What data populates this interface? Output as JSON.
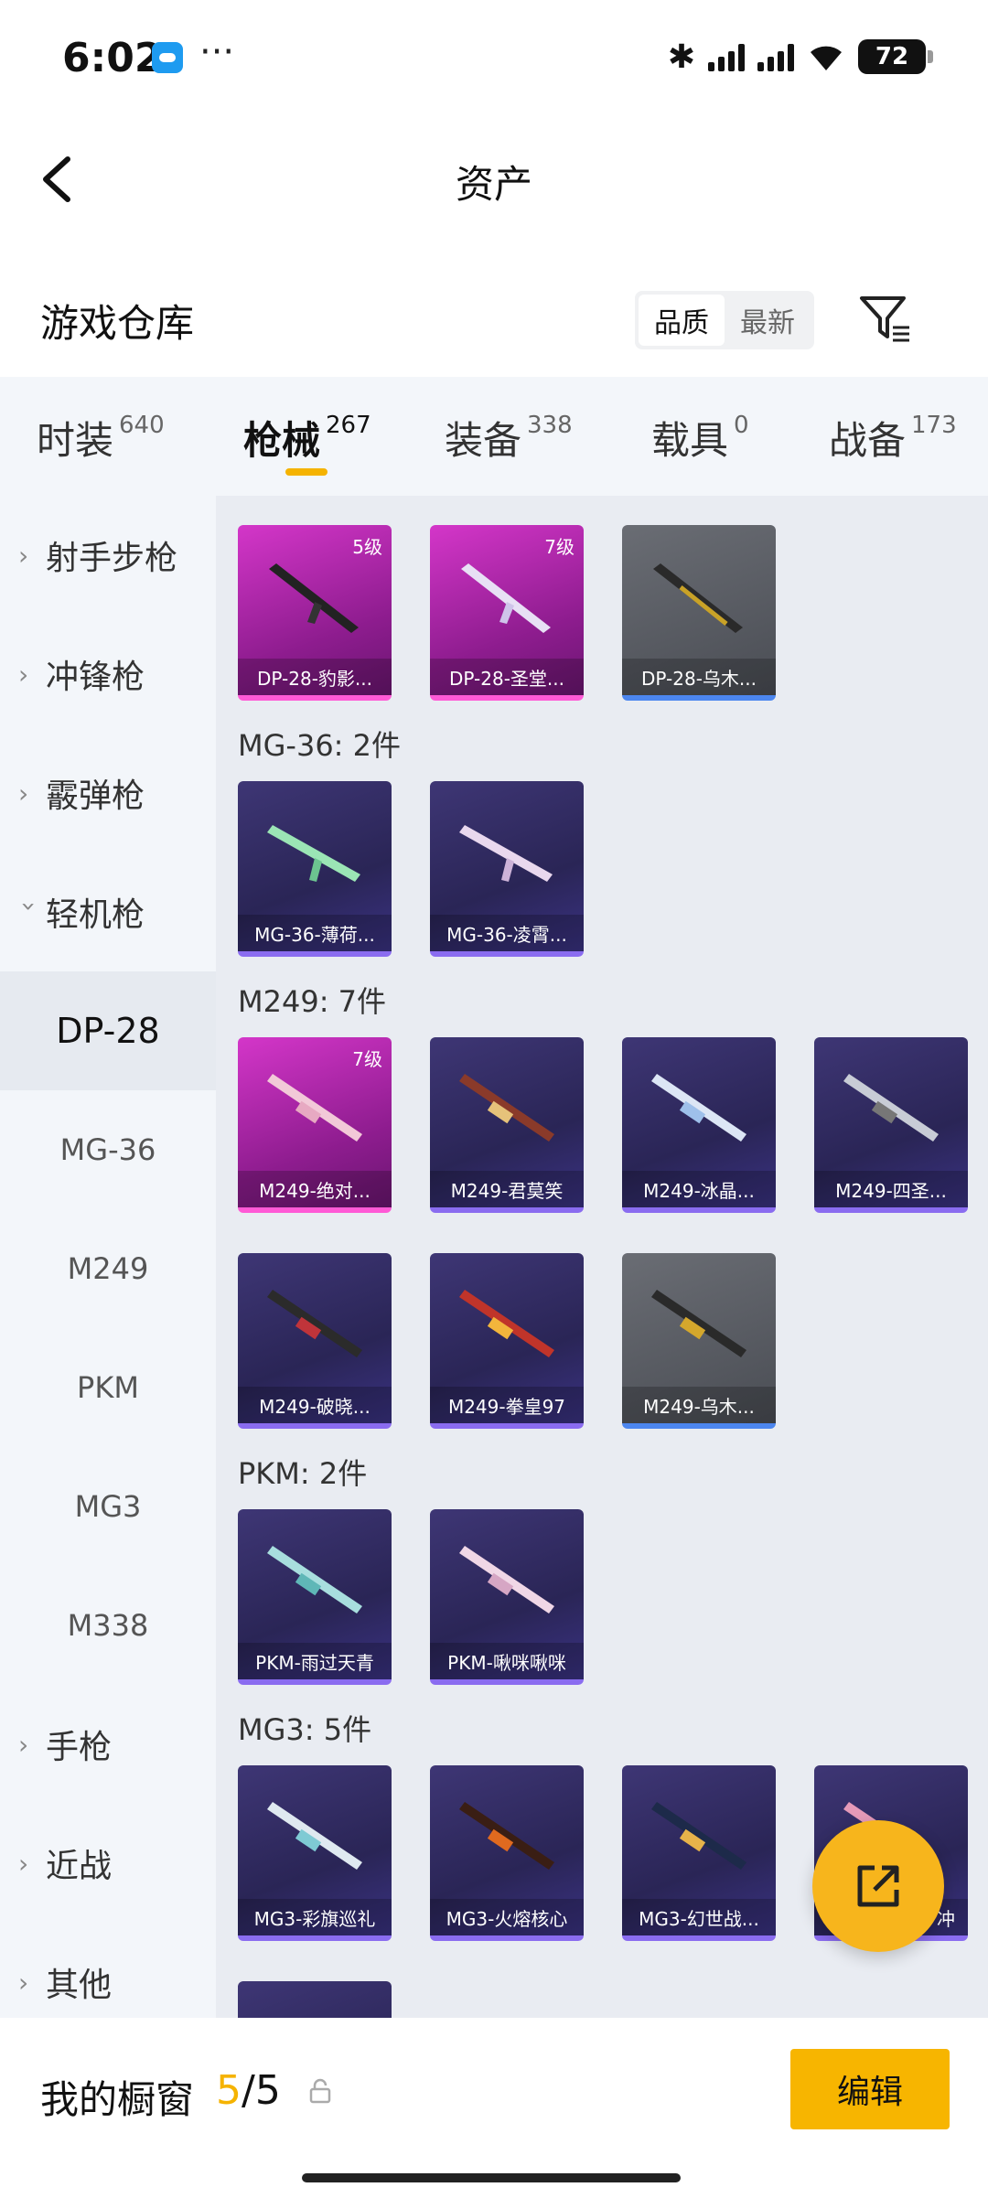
{
  "status": {
    "time": "6:02",
    "battery": "72"
  },
  "header": {
    "title": "资产"
  },
  "warehouse": {
    "title": "游戏仓库",
    "sort": [
      "品质",
      "最新"
    ]
  },
  "tabs": [
    {
      "label": "时装",
      "count": "640"
    },
    {
      "label": "枪械",
      "count": "267"
    },
    {
      "label": "装备",
      "count": "338"
    },
    {
      "label": "载具",
      "count": "0"
    },
    {
      "label": "战备",
      "count": "173"
    }
  ],
  "sidebar": {
    "categories": [
      "射手步枪",
      "冲锋枪",
      "霰弹枪",
      "轻机枪",
      "手枪",
      "近战",
      "其他"
    ],
    "sub": [
      "DP-28",
      "MG-36",
      "M249",
      "PKM",
      "MG3",
      "M338"
    ]
  },
  "content": {
    "dp28": [
      {
        "name": "DP-28-豹影...",
        "level": "5级"
      },
      {
        "name": "DP-28-圣堂...",
        "level": "7级"
      },
      {
        "name": "DP-28-乌木..."
      }
    ],
    "mg36_title": "MG-36: 2件",
    "mg36": [
      {
        "name": "MG-36-薄荷..."
      },
      {
        "name": "MG-36-凌霄..."
      }
    ],
    "m249_title": "M249: 7件",
    "m249": [
      {
        "name": "M249-绝对...",
        "level": "7级"
      },
      {
        "name": "M249-君莫笑"
      },
      {
        "name": "M249-冰晶..."
      },
      {
        "name": "M249-四圣..."
      },
      {
        "name": "M249-破晓..."
      },
      {
        "name": "M249-拳皇97"
      },
      {
        "name": "M249-乌木..."
      }
    ],
    "pkm_title": "PKM: 2件",
    "pkm": [
      {
        "name": "PKM-雨过天青"
      },
      {
        "name": "PKM-啾咪啾咪"
      }
    ],
    "mg3_title": "MG3: 5件",
    "mg3": [
      {
        "name": "MG3-彩旗巡礼"
      },
      {
        "name": "MG3-火熔核心"
      },
      {
        "name": "MG3-幻世战..."
      },
      {
        "name": "冲"
      }
    ]
  },
  "bottom": {
    "label": "我的橱窗",
    "current": "5",
    "total": "/5",
    "edit": "编辑"
  },
  "colors": {
    "accent": "#f5b300",
    "gold_card": "#b42ab0",
    "purple_card": "#2f2a60",
    "gray_card": "#5a5d64"
  }
}
